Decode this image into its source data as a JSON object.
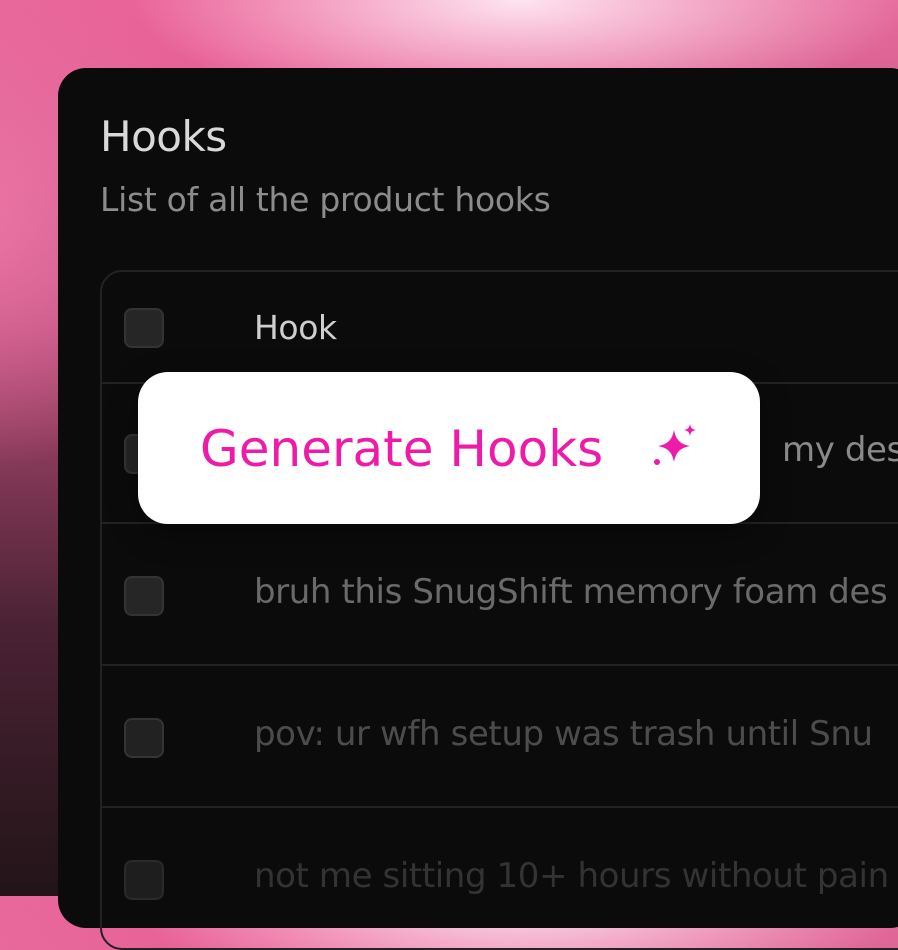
{
  "page": {
    "title": "Hooks",
    "subtitle": "List of all the product hooks"
  },
  "table": {
    "header": {
      "hook_label": "Hook"
    },
    "rows": [
      {
        "text": "my desk"
      },
      {
        "text": "bruh this SnugShift memory foam des"
      },
      {
        "text": "pov: ur wfh setup was trash until Snu"
      },
      {
        "text": "not me sitting 10+ hours without pain"
      }
    ]
  },
  "generate_button": {
    "label": "Generate Hooks",
    "icon": "sparkle-icon",
    "text_color": "#ee1aa8"
  },
  "colors": {
    "panel_bg": "#0b0b0b",
    "accent": "#ee1aa8"
  }
}
